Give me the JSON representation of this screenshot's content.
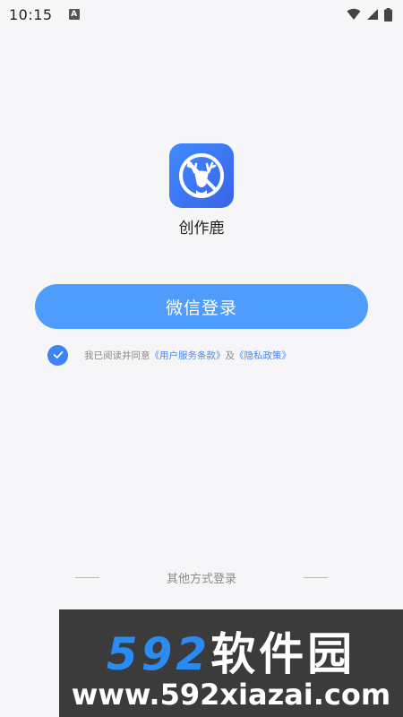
{
  "status_bar": {
    "time": "10:15",
    "notification_icon": "A",
    "icons": [
      "wifi-icon",
      "signal-icon",
      "battery-icon"
    ]
  },
  "app": {
    "name": "创作鹿",
    "logo_icon": "deer-logo-icon",
    "brand_color": "#3f8bff"
  },
  "login": {
    "wechat_button": "微信登录",
    "button_color": "#4e9cfb"
  },
  "agreement": {
    "checked": true,
    "prefix": "我已阅读并同意",
    "terms_link": "《用户服务条款》",
    "conjunction": "及",
    "privacy_link": "《隐私政策》",
    "link_color": "#4a86e8"
  },
  "other_login": {
    "label": "其他方式登录"
  },
  "watermark": {
    "brand_number": "592",
    "brand_text": "软件园",
    "url": "www.592xiazai.com"
  }
}
